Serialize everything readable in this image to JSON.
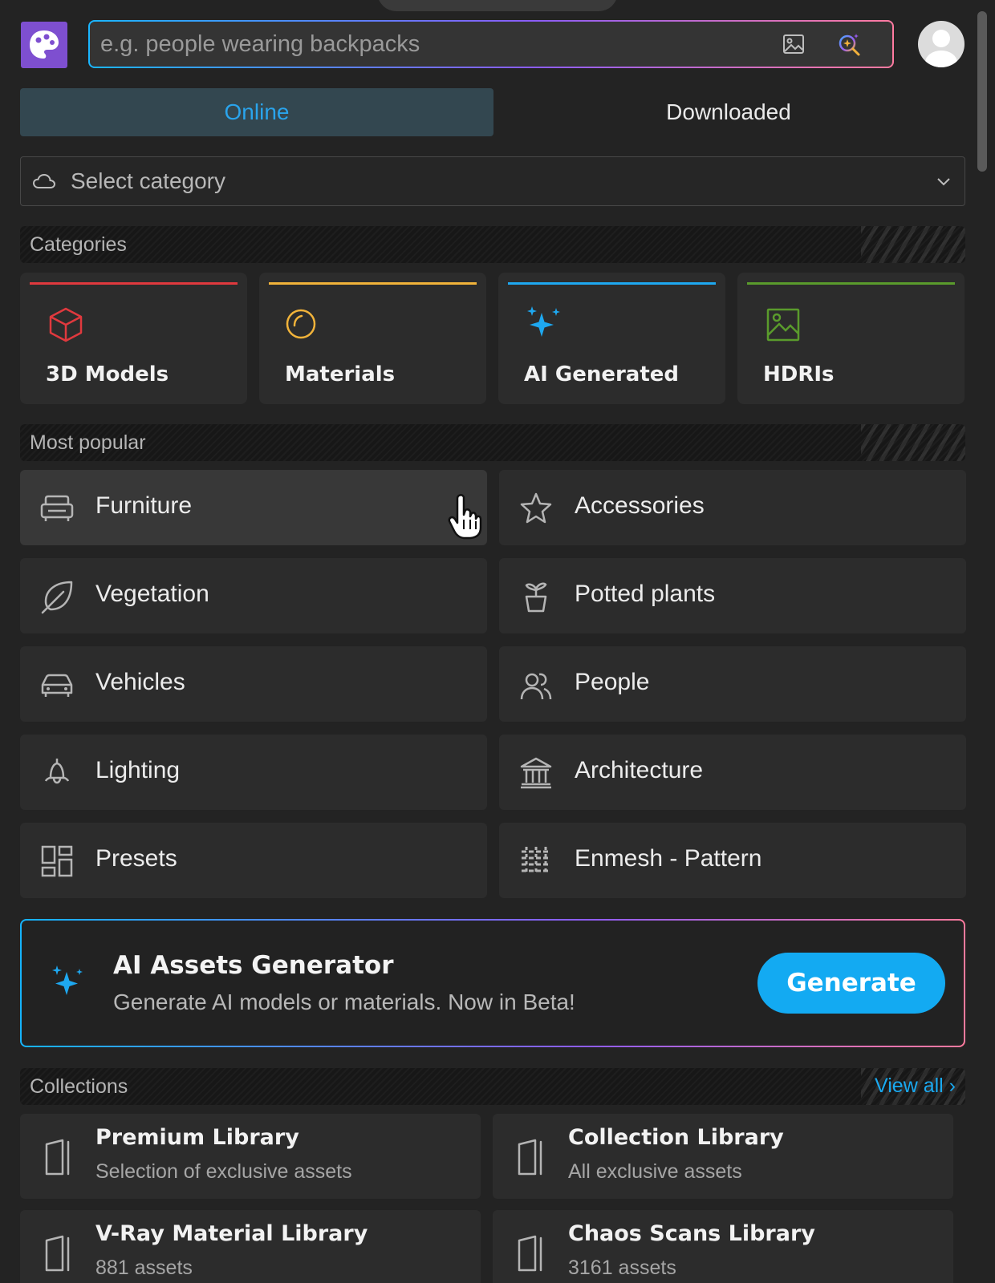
{
  "search": {
    "placeholder": "e.g. people wearing backpacks"
  },
  "tabs": [
    {
      "label": "Online",
      "active": true
    },
    {
      "label": "Downloaded",
      "active": false
    }
  ],
  "category_select": {
    "placeholder": "Select category"
  },
  "sections": {
    "categories": "Categories",
    "most_popular": "Most popular",
    "collections": "Collections",
    "view_all": "View all ›"
  },
  "categories": [
    {
      "label": "3D Models",
      "icon": "cube-icon",
      "color": "#e0393e"
    },
    {
      "label": "Materials",
      "icon": "material-sphere-icon",
      "color": "#f1b33a"
    },
    {
      "label": "AI Generated",
      "icon": "sparkles-icon",
      "color": "#1ea8f0"
    },
    {
      "label": "HDRIs",
      "icon": "image-icon",
      "color": "#5a9b2c"
    }
  ],
  "popular": [
    {
      "label": "Furniture",
      "icon": "sofa-icon"
    },
    {
      "label": "Accessories",
      "icon": "star-icon"
    },
    {
      "label": "Vegetation",
      "icon": "leaf-icon"
    },
    {
      "label": "Potted plants",
      "icon": "potted-plant-icon"
    },
    {
      "label": "Vehicles",
      "icon": "car-icon"
    },
    {
      "label": "People",
      "icon": "people-icon"
    },
    {
      "label": "Lighting",
      "icon": "lamp-icon"
    },
    {
      "label": "Architecture",
      "icon": "building-icon"
    },
    {
      "label": "Presets",
      "icon": "layout-icon"
    },
    {
      "label": "Enmesh - Pattern",
      "icon": "pattern-icon"
    }
  ],
  "ai_banner": {
    "title": "AI Assets Generator",
    "subtitle": "Generate AI models or materials. Now in Beta!",
    "button": "Generate"
  },
  "collections": [
    {
      "title": "Premium Library",
      "desc": "Selection of exclusive assets"
    },
    {
      "title": "Collection Library",
      "desc": "All exclusive assets"
    },
    {
      "title": "V-Ray Material Library",
      "desc": "881 assets"
    },
    {
      "title": "Chaos Scans Library",
      "desc": "3161 assets"
    }
  ],
  "colors": {
    "accent": "#1aa9f0",
    "logo": "#7e4fd0",
    "background": "#232323",
    "card": "#2c2c2c"
  }
}
